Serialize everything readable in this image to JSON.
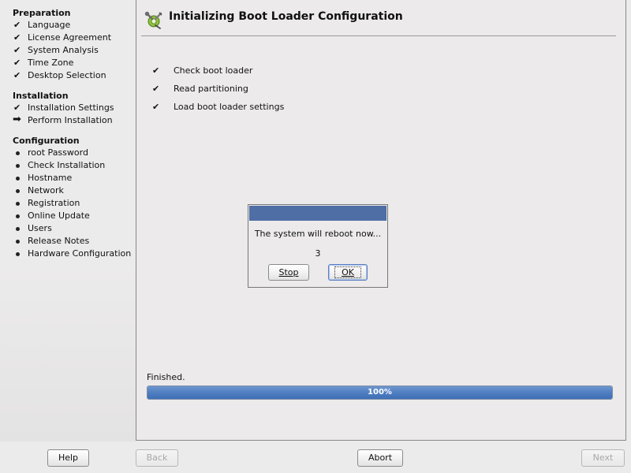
{
  "sidebar": {
    "sections": [
      {
        "title": "Preparation",
        "steps": [
          {
            "label": "Language",
            "status": "done"
          },
          {
            "label": "License Agreement",
            "status": "done"
          },
          {
            "label": "System Analysis",
            "status": "done"
          },
          {
            "label": "Time Zone",
            "status": "done"
          },
          {
            "label": "Desktop Selection",
            "status": "done"
          }
        ]
      },
      {
        "title": "Installation",
        "steps": [
          {
            "label": "Installation Settings",
            "status": "done"
          },
          {
            "label": "Perform Installation",
            "status": "current"
          }
        ]
      },
      {
        "title": "Configuration",
        "steps": [
          {
            "label": "root Password",
            "status": "pending"
          },
          {
            "label": "Check Installation",
            "status": "pending"
          },
          {
            "label": "Hostname",
            "status": "pending"
          },
          {
            "label": "Network",
            "status": "pending"
          },
          {
            "label": "Registration",
            "status": "pending"
          },
          {
            "label": "Online Update",
            "status": "pending"
          },
          {
            "label": "Users",
            "status": "pending"
          },
          {
            "label": "Release Notes",
            "status": "pending"
          },
          {
            "label": "Hardware Configuration",
            "status": "pending"
          }
        ]
      }
    ]
  },
  "header": {
    "title": "Initializing Boot Loader Configuration",
    "icon": "boot-loader-tools-icon"
  },
  "tasks": [
    {
      "label": "Check boot loader",
      "status": "done"
    },
    {
      "label": "Read partitioning",
      "status": "done"
    },
    {
      "label": "Load boot loader settings",
      "status": "done"
    }
  ],
  "progress": {
    "status_label": "Finished.",
    "percent": 100,
    "text": "100%"
  },
  "dialog": {
    "message": "The system will reboot now...",
    "countdown": "3",
    "stop_label": "Stop",
    "ok_label": "OK"
  },
  "buttons": {
    "help": "Help",
    "back": "Back",
    "abort": "Abort",
    "next": "Next"
  },
  "colors": {
    "progress_fill": "#4f7ec2",
    "dialog_titlebar": "#4e6ea5"
  }
}
